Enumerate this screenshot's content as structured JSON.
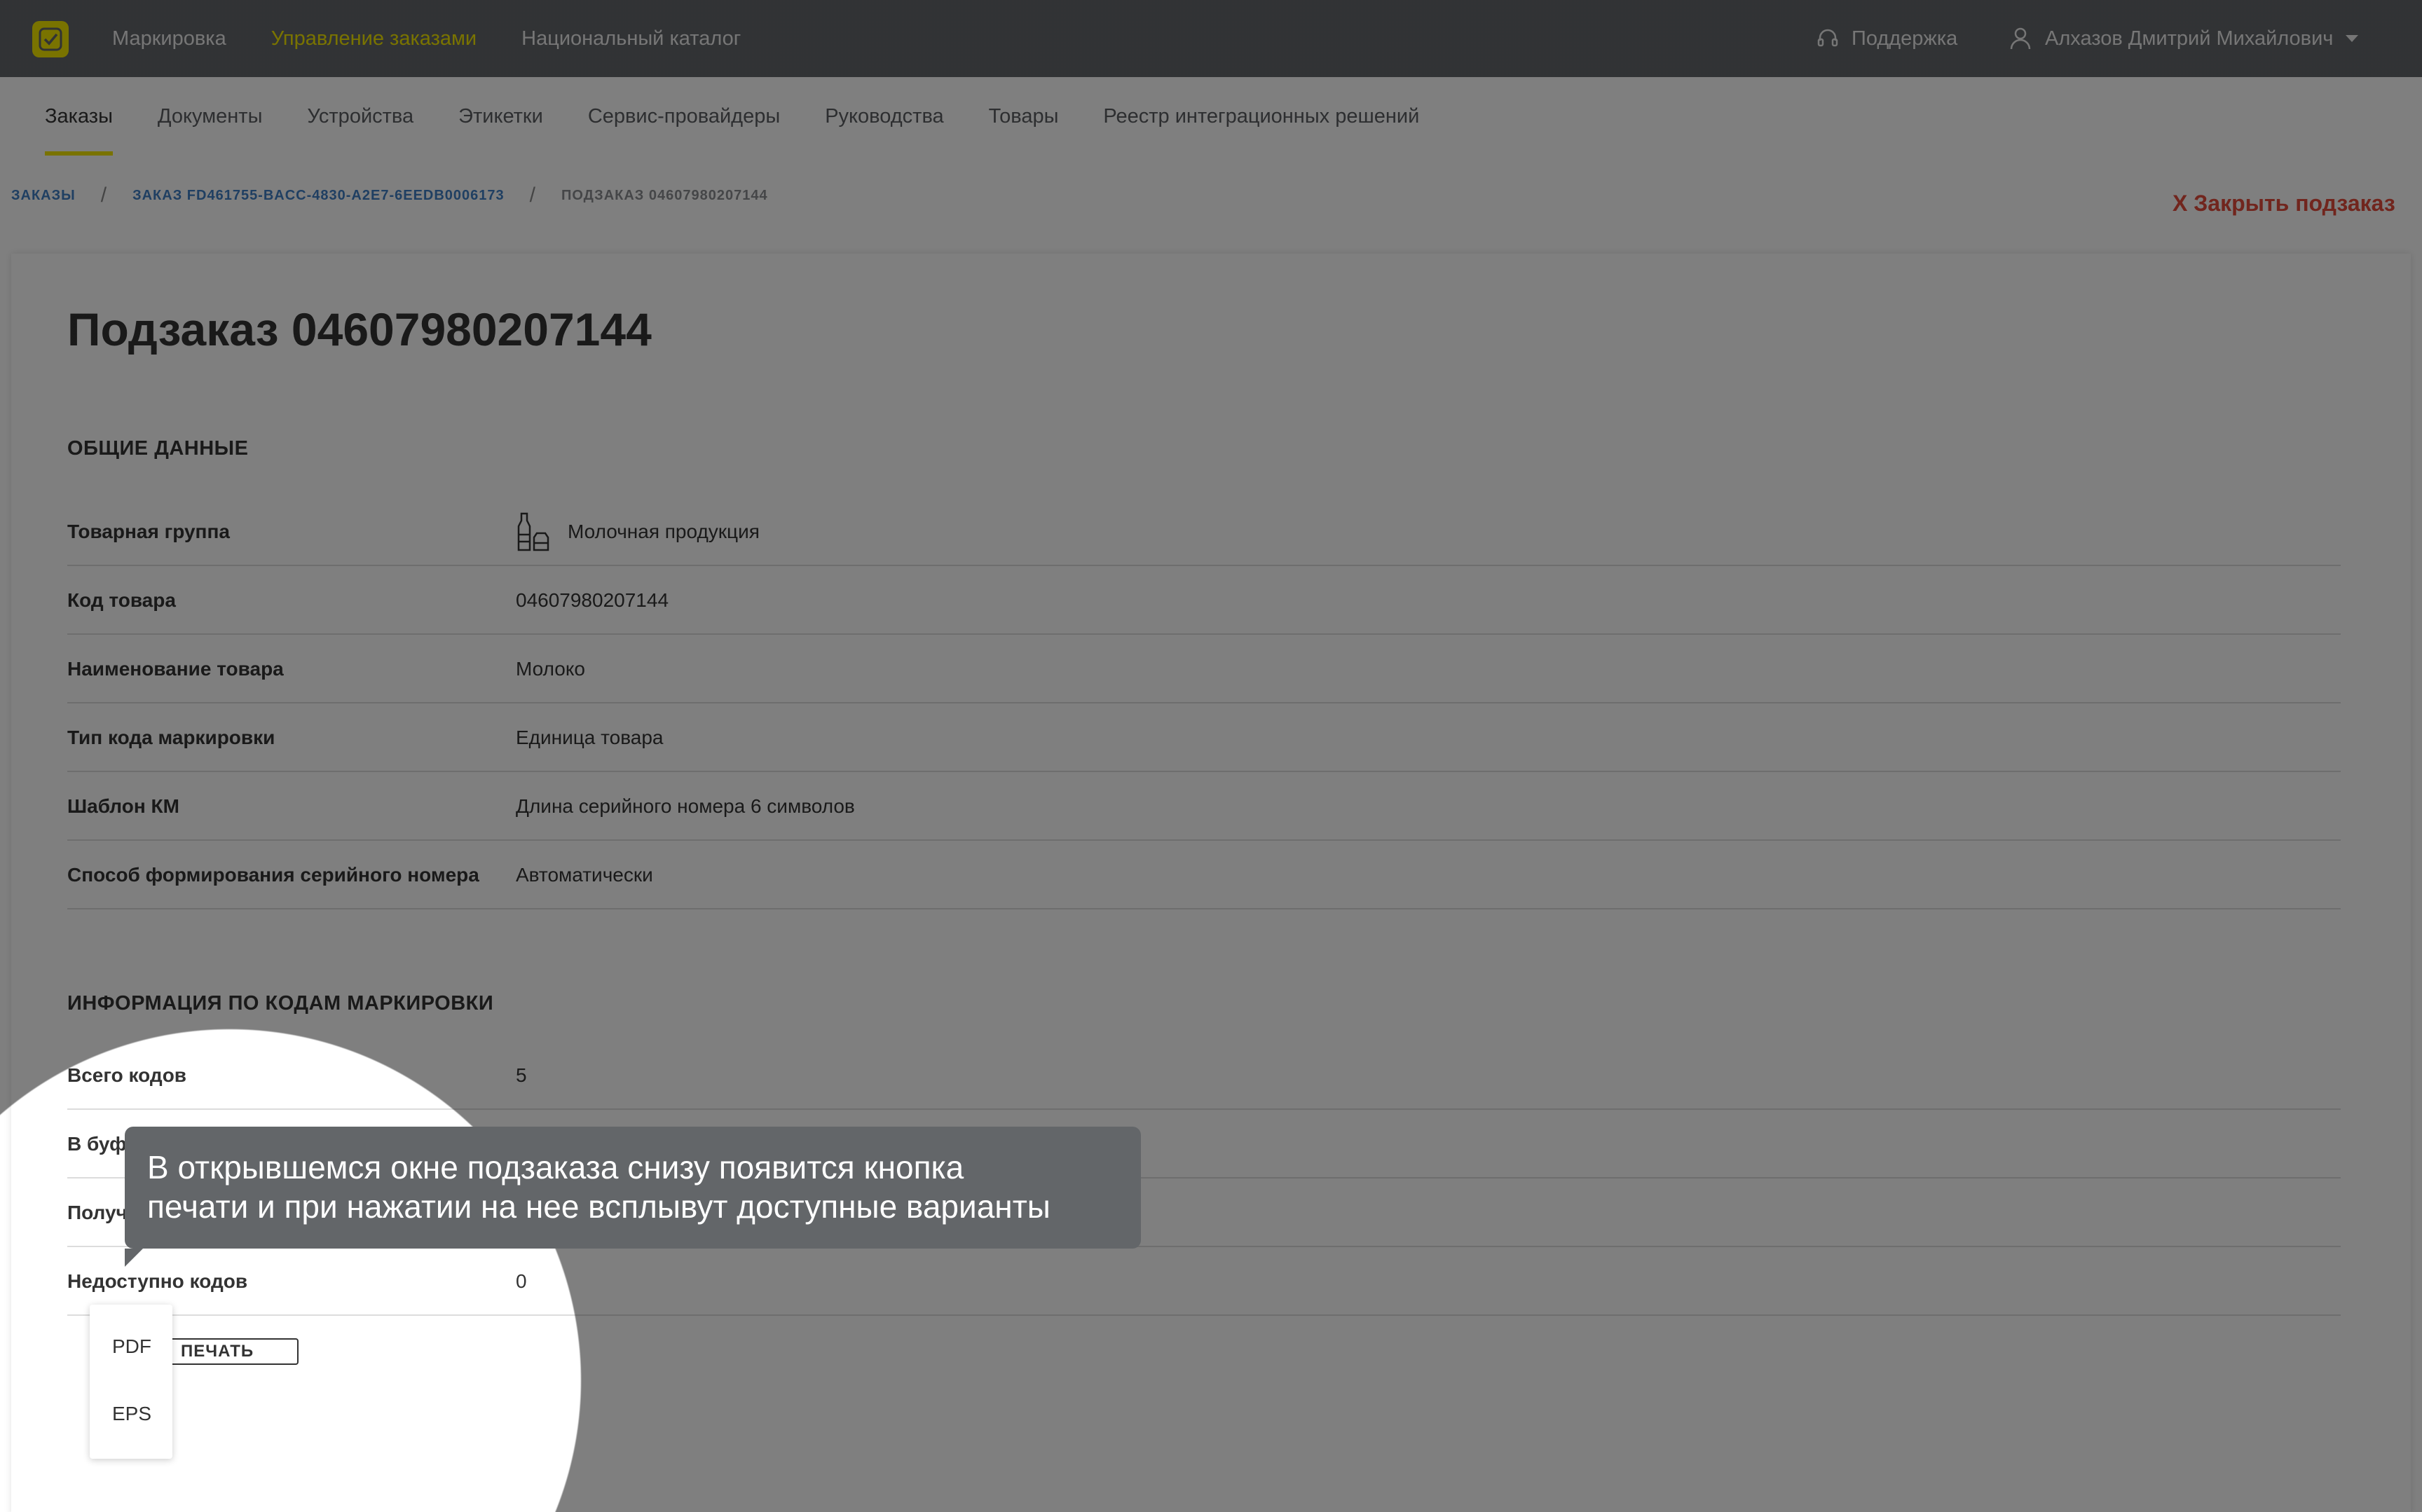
{
  "topbar": {
    "nav": [
      "Маркировка",
      "Управление заказами",
      "Национальный каталог"
    ],
    "active_index": 1,
    "support_label": "Поддержка",
    "user_name": "Алхазов Дмитрий Михайлович",
    "brand_color": "#f2e600"
  },
  "subnav": {
    "items": [
      "Заказы",
      "Документы",
      "Устройства",
      "Этикетки",
      "Сервис-провайдеры",
      "Руководства",
      "Товары",
      "Реестр интеграционных решений"
    ],
    "active_index": 0
  },
  "breadcrumb": {
    "items": [
      "ЗАКАЗЫ",
      "ЗАКАЗ FD461755-BACC-4830-A2E7-6EEDB0006173",
      "ПОДЗАКАЗ 04607980207144"
    ],
    "separator": "/"
  },
  "close_label": "X Закрыть подзаказ",
  "page_title": "Подзаказ 04607980207144",
  "general": {
    "title": "ОБЩИЕ ДАННЫЕ",
    "rows": [
      {
        "label": "Товарная группа",
        "value": "Молочная продукция",
        "icon": "milk-bottle-icon"
      },
      {
        "label": "Код товара",
        "value": "04607980207144"
      },
      {
        "label": "Наименование товара",
        "value": "Молоко"
      },
      {
        "label": "Тип кода маркировки",
        "value": "Единица товара"
      },
      {
        "label": "Шаблон КМ",
        "value": "Длина серийного номера 6 символов"
      },
      {
        "label": "Способ формирования серийного номера",
        "value": "Автоматически"
      }
    ]
  },
  "codes": {
    "title": "ИНФОРМАЦИЯ ПО КОДАМ МАРКИРОВКИ",
    "rows": [
      {
        "label": "Всего кодов",
        "value": "5"
      },
      {
        "label": "В буф",
        "value": ""
      },
      {
        "label": "Получ",
        "value": ""
      },
      {
        "label": "Недоступно кодов",
        "value": "0"
      }
    ]
  },
  "print": {
    "label": "ПЕЧАТЬ",
    "options": [
      "PDF",
      "EPS"
    ]
  },
  "tooltip": {
    "line1": "В открывшемся окне подзаказа снизу появится кнопка",
    "line2": "печати и при нажатии на нее всплывут доступные варианты"
  }
}
